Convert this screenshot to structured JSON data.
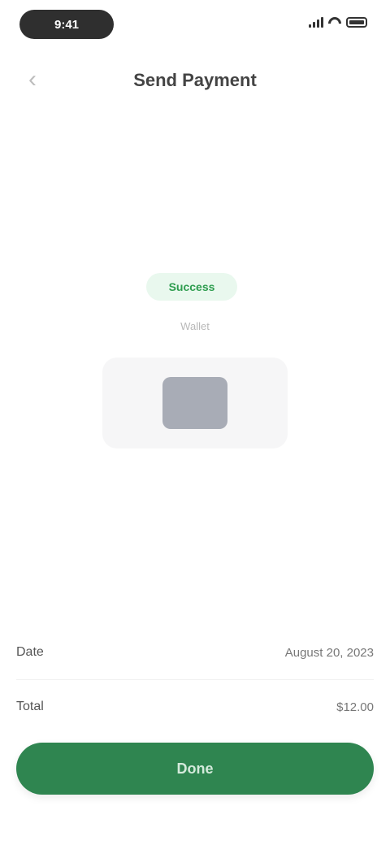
{
  "status_bar": {
    "time": "9:41"
  },
  "header": {
    "back_icon": "chevron-left-icon",
    "title": "Send Payment"
  },
  "status": {
    "label": "Success",
    "sublabel": "Wallet",
    "color": "#2e9d4f"
  },
  "card": {
    "icon": "wallet-icon"
  },
  "details": [
    {
      "label": "Date",
      "value": "August 20, 2023"
    },
    {
      "label": "Total",
      "value": "$12.00"
    }
  ],
  "cta": {
    "label": "Done",
    "color": "#2f8550"
  }
}
